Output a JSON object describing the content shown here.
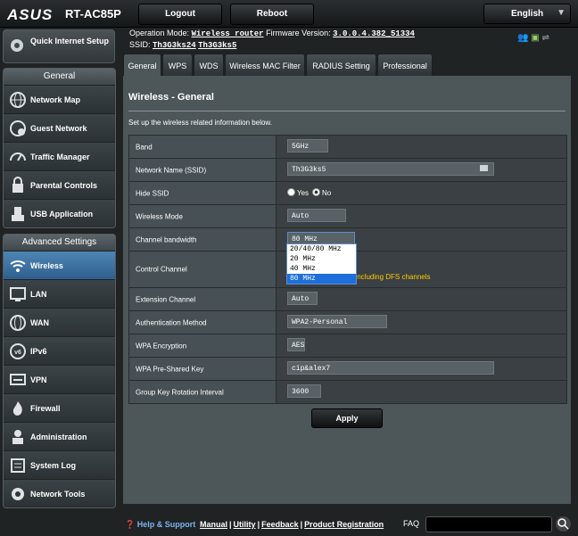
{
  "header": {
    "logo": "ASUS",
    "model": "RT-AC85P",
    "logout_label": "Logout",
    "reboot_label": "Reboot",
    "language": "English"
  },
  "status": {
    "operation_mode_label": "Operation Mode:",
    "operation_mode": "Wireless router",
    "firmware_label": "Firmware Version:",
    "firmware": "3.0.0.4.382_51334",
    "ssid_label": "SSID:",
    "ssid_1": "Th3G3ks24",
    "ssid_2": "Th3G3ks5"
  },
  "sidebar": {
    "quick_setup": "Quick Internet Setup",
    "general_header": "General",
    "general_items": [
      {
        "label": "Network Map"
      },
      {
        "label": "Guest Network"
      },
      {
        "label": "Traffic Manager"
      },
      {
        "label": "Parental Controls"
      },
      {
        "label": "USB Application"
      }
    ],
    "advanced_header": "Advanced Settings",
    "advanced_items": [
      {
        "label": "Wireless"
      },
      {
        "label": "LAN"
      },
      {
        "label": "WAN"
      },
      {
        "label": "IPv6"
      },
      {
        "label": "VPN"
      },
      {
        "label": "Firewall"
      },
      {
        "label": "Administration"
      },
      {
        "label": "System Log"
      },
      {
        "label": "Network Tools"
      }
    ]
  },
  "tabs": [
    "General",
    "WPS",
    "WDS",
    "Wireless MAC Filter",
    "RADIUS Setting",
    "Professional"
  ],
  "main": {
    "title": "Wireless - General",
    "description": "Set up the wireless related information below.",
    "rows": {
      "band": {
        "label": "Band",
        "value": "5GHz"
      },
      "ssid": {
        "label": "Network Name (SSID)",
        "value": "Th3G3ks5"
      },
      "hide_ssid": {
        "label": "Hide SSID",
        "yes": "Yes",
        "no": "No"
      },
      "wireless_mode": {
        "label": "Wireless Mode",
        "value": "Auto"
      },
      "channel_bandwidth": {
        "label": "Channel bandwidth",
        "value": "80 MHz"
      },
      "control_channel": {
        "label": "Control Channel",
        "note": "el including DFS channels"
      },
      "extension_channel": {
        "label": "Extension Channel",
        "value": "Auto"
      },
      "auth_method": {
        "label": "Authentication Method",
        "value": "WPA2-Personal"
      },
      "wpa_encryption": {
        "label": "WPA Encryption",
        "value": "AES"
      },
      "wpa_key": {
        "label": "WPA Pre-Shared Key",
        "value": "cip&alex7"
      },
      "group_key": {
        "label": "Group Key Rotation Interval",
        "value": "3600"
      }
    },
    "bandwidth_options": [
      "20/40/80 MHz",
      "20 MHz",
      "40 MHz",
      "80 MHz"
    ],
    "apply_label": "Apply"
  },
  "footer": {
    "help": "Help & Support",
    "manual": "Manual",
    "utility": "Utility",
    "feedback": "Feedback",
    "registration": "Product Registration",
    "faq": "FAQ"
  },
  "colors": {
    "active_menu": "#3a72a6",
    "dfs_note": "#ffcc00",
    "selected_option": "#1e6fd9"
  }
}
